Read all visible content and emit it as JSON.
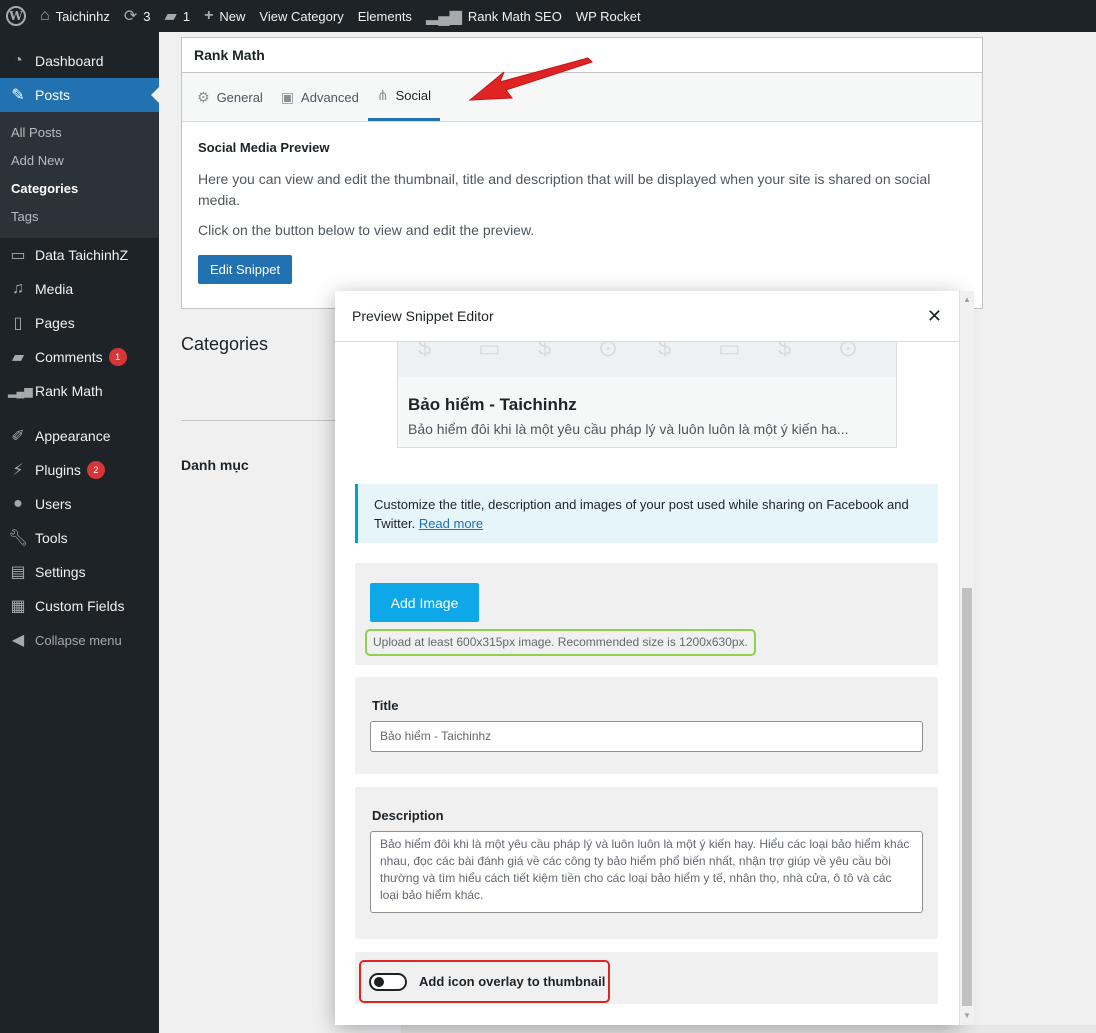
{
  "adminbar": {
    "site_name": "Taichinhz",
    "updates_count": "3",
    "comments_count": "1",
    "new_label": "New",
    "view_category": "View Category",
    "elements": "Elements",
    "rank_math": "Rank Math SEO",
    "wp_rocket": "WP Rocket"
  },
  "sidebar": {
    "dashboard": "Dashboard",
    "posts": "Posts",
    "all_posts": "All Posts",
    "add_new": "Add New",
    "categories": "Categories",
    "tags": "Tags",
    "data_taichinhz": "Data TaichinhZ",
    "media": "Media",
    "pages": "Pages",
    "comments": "Comments",
    "comments_badge": "1",
    "rank_math": "Rank Math",
    "appearance": "Appearance",
    "plugins": "Plugins",
    "plugins_badge": "2",
    "users": "Users",
    "tools": "Tools",
    "settings": "Settings",
    "custom_fields": "Custom Fields",
    "collapse": "Collapse menu"
  },
  "rankmath_box": {
    "title": "Rank Math",
    "tab_general": "General",
    "tab_advanced": "Advanced",
    "tab_social": "Social",
    "heading": "Social Media Preview",
    "para1": "Here you can view and edit the thumbnail, title and description that will be displayed when your site is shared on social media.",
    "para2": "Click on the button below to view and edit the preview.",
    "edit_button": "Edit Snippet"
  },
  "page": {
    "categories_title": "Categories",
    "danh_muc": "Danh mục"
  },
  "modal": {
    "title": "Preview Snippet Editor",
    "preview_title": "Bảo hiểm - Taichinhz",
    "preview_desc": "Bảo hiểm đôi khi là một yêu cầu pháp lý và luôn luôn là một ý kiến ha...",
    "notice_text": "Customize the title, description and images of your post used while sharing on Facebook and Twitter.",
    "notice_link": "Read more",
    "add_image": "Add Image",
    "upload_hint": "Upload at least 600x315px image. Recommended size is 1200x630px.",
    "title_label": "Title",
    "title_value": "Bảo hiểm - Taichinhz",
    "description_label": "Description",
    "description_value": "Bảo hiểm đôi khi là một yêu cầu pháp lý và luôn luôn là một ý kiến hay. Hiểu các loại bảo hiểm khác nhau, đọc các bài đánh giá về các công ty bảo hiểm phổ biến nhất, nhận trợ giúp về yêu cầu bồi thường và tìm hiểu cách tiết kiệm tiền cho các loại bảo hiểm y tế, nhân thọ, nhà cửa, ô tô và các loại bảo hiểm khác.",
    "toggle_label": "Add icon overlay to thumbnail",
    "toggle_on": false
  },
  "colors": {
    "admin_dark": "#1d2327",
    "wp_blue": "#2271b1",
    "add_image_blue": "#0ea7e8",
    "highlight_green": "#8fd14f",
    "highlight_red": "#e02424"
  }
}
